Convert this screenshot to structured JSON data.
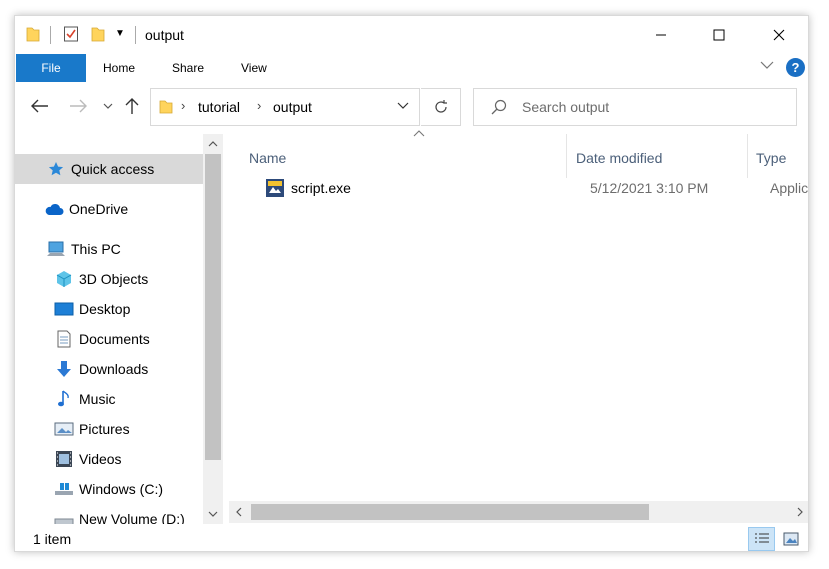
{
  "window": {
    "title": "output"
  },
  "ribbon": {
    "tabs": [
      "File",
      "Home",
      "Share",
      "View"
    ],
    "help": "?"
  },
  "address": {
    "parts": [
      "tutorial",
      "output"
    ]
  },
  "search": {
    "placeholder": "Search output"
  },
  "navpane": {
    "items": [
      {
        "label": "Quick access",
        "icon": "star-icon"
      },
      {
        "label": "OneDrive",
        "icon": "cloud-icon"
      },
      {
        "label": "This PC",
        "icon": "computer-icon"
      },
      {
        "label": "3D Objects",
        "icon": "cube-icon"
      },
      {
        "label": "Desktop",
        "icon": "desktop-icon"
      },
      {
        "label": "Documents",
        "icon": "document-icon"
      },
      {
        "label": "Downloads",
        "icon": "download-icon"
      },
      {
        "label": "Music",
        "icon": "music-icon"
      },
      {
        "label": "Pictures",
        "icon": "pictures-icon"
      },
      {
        "label": "Videos",
        "icon": "video-icon"
      },
      {
        "label": "Windows (C:)",
        "icon": "drive-icon"
      },
      {
        "label": "New Volume (D:)",
        "icon": "drive-icon"
      }
    ]
  },
  "columns": {
    "name": "Name",
    "date": "Date modified",
    "type": "Type"
  },
  "files": [
    {
      "name": "script.exe",
      "date": "5/12/2021 3:10 PM",
      "type": "Applicati"
    }
  ],
  "status": {
    "count": "1 item"
  },
  "colors": {
    "accent": "#1979ca",
    "selected": "#d9d9d9",
    "header_text": "#4c607a"
  }
}
